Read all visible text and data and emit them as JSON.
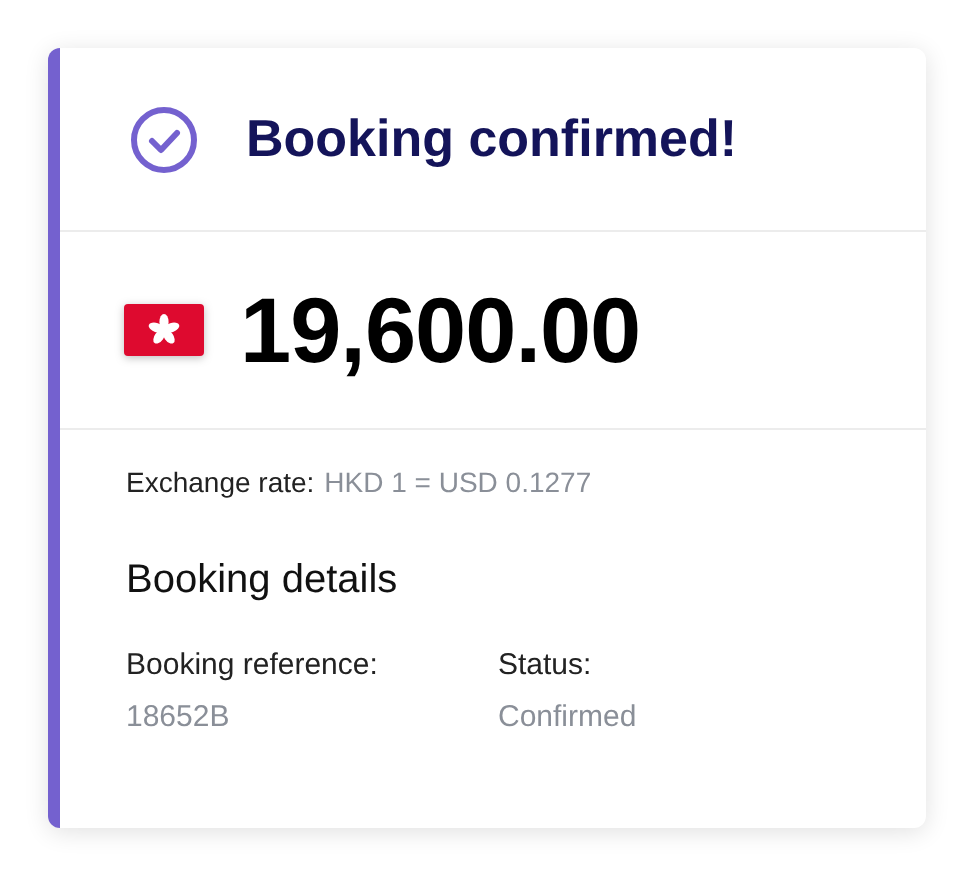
{
  "title": "Booking confirmed!",
  "amount": {
    "value": "19,600.00"
  },
  "exchange_rate": {
    "label": "Exchange rate:",
    "value": "HKD 1 = USD 0.1277"
  },
  "details": {
    "heading": "Booking details",
    "fields": [
      {
        "label": "Booking reference:",
        "value": "18652B"
      },
      {
        "label": "Status:",
        "value": "Confirmed"
      }
    ]
  }
}
